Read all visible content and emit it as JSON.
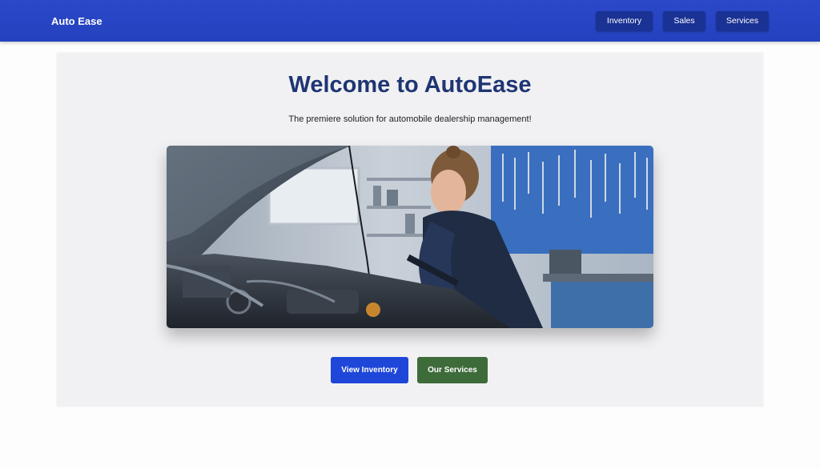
{
  "navbar": {
    "brand": "Auto Ease",
    "links": [
      {
        "label": "Inventory"
      },
      {
        "label": "Sales"
      },
      {
        "label": "Services"
      }
    ]
  },
  "hero": {
    "title": "Welcome to AutoEase",
    "subtitle": "The premiere solution for automobile dealership management!",
    "image": {
      "icon": "mechanic-photo"
    },
    "buttons": {
      "primary": "View Inventory",
      "secondary": "Our Services"
    }
  },
  "colors": {
    "navbar": "#2442bf",
    "nav_button": "#1a3294",
    "title": "#1f3573",
    "primary_button": "#1e46d8",
    "secondary_button": "#3d6b3a",
    "hero_background": "#f1f1f3"
  }
}
